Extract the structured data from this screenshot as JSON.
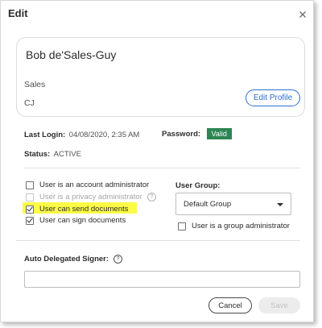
{
  "dialog": {
    "title": "Edit",
    "close_icon": "close-icon"
  },
  "profile_card": {
    "name": "Bob de'Sales-Guy",
    "department": "Sales",
    "initials": "CJ",
    "edit_profile_label": "Edit Profile"
  },
  "info": {
    "last_login_label": "Last Login:",
    "last_login_value": "04/08/2020, 2:35 AM",
    "password_label": "Password:",
    "password_status": "Valid",
    "status_label": "Status:",
    "status_value": "ACTIVE"
  },
  "permissions": [
    {
      "label": "User is an account administrator",
      "checked": false,
      "disabled": false
    },
    {
      "label": "User is a privacy administrator",
      "checked": false,
      "disabled": true,
      "icon": "help-icon"
    },
    {
      "label": "User can send documents",
      "checked": true,
      "disabled": false,
      "highlighted": true
    },
    {
      "label": "User can sign documents",
      "checked": true,
      "disabled": false
    }
  ],
  "user_group": {
    "label": "User Group:",
    "selected": "Default Group",
    "group_admin_label": "User is a group administrator",
    "group_admin_checked": false
  },
  "delegated_signer": {
    "label": "Auto Delegated Signer:",
    "icon": "help-icon",
    "value": ""
  },
  "buttons": {
    "cancel": "Cancel",
    "save": "Save"
  },
  "colors": {
    "accent": "#2d6fd1",
    "valid_badge": "#2d8553",
    "highlight": "#fbfb48"
  }
}
